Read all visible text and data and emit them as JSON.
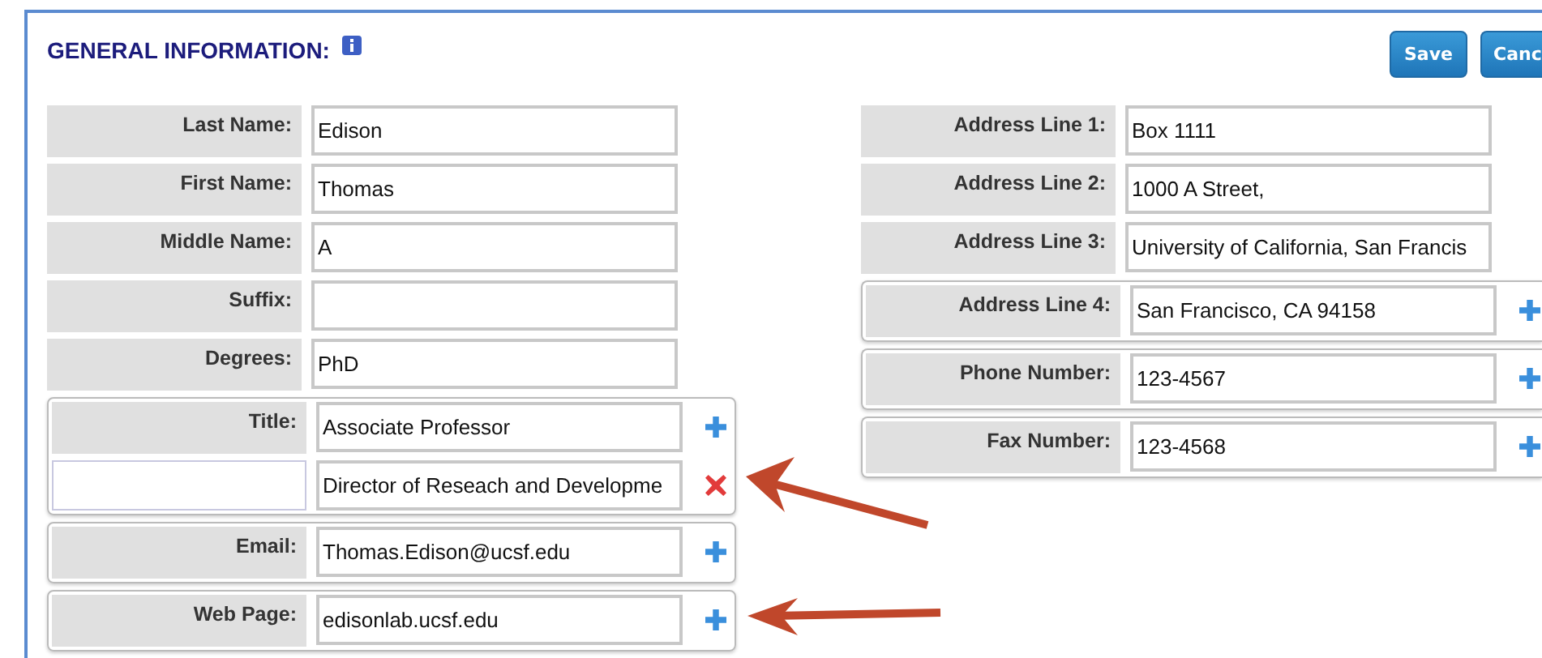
{
  "header": {
    "title": "GENERAL INFORMATION:",
    "buttons": [
      "Save",
      "Canc"
    ]
  },
  "columns": [
    [
      {
        "kind": "single",
        "label": "Last Name:",
        "value": "Edison"
      },
      {
        "kind": "single",
        "label": "First Name:",
        "value": "Thomas"
      },
      {
        "kind": "single",
        "label": "Middle Name:",
        "value": "A"
      },
      {
        "kind": "single",
        "label": "Suffix:"
      },
      {
        "kind": "single",
        "label": "Degrees:",
        "value": "PhD"
      },
      {
        "kind": "multi",
        "label": "Title:",
        "entries": [
          {
            "value": "Associate Professor",
            "kind": "add"
          },
          {
            "value": "Director of Reseach and Developme",
            "kind": "remove"
          }
        ]
      },
      {
        "kind": "multi",
        "label": "Email:",
        "entries": [
          {
            "value": "Thomas.Edison@ucsf.edu",
            "kind": "add"
          }
        ]
      },
      {
        "kind": "multi",
        "label": "Web Page:",
        "entries": [
          {
            "value": "edisonlab.ucsf.edu",
            "kind": "add"
          }
        ]
      }
    ],
    [
      {
        "kind": "single",
        "label": "Address Line 1:",
        "value": "Box 1111"
      },
      {
        "kind": "single",
        "label": "Address Line 2:",
        "value": "1000 A Street,"
      },
      {
        "kind": "single",
        "label": "Address Line 3:",
        "value": "University of California, San Francis"
      },
      {
        "kind": "multi",
        "label": "Address Line 4:",
        "entries": [
          {
            "value": "San Francisco, CA 94158",
            "kind": "add"
          }
        ]
      },
      {
        "kind": "multi",
        "label": "Phone Number:",
        "entries": [
          {
            "value": "123-4567",
            "kind": "add"
          }
        ]
      },
      {
        "kind": "multi",
        "label": "Fax Number:",
        "entries": [
          {
            "value": "123-4568",
            "kind": "add"
          }
        ]
      }
    ]
  ]
}
